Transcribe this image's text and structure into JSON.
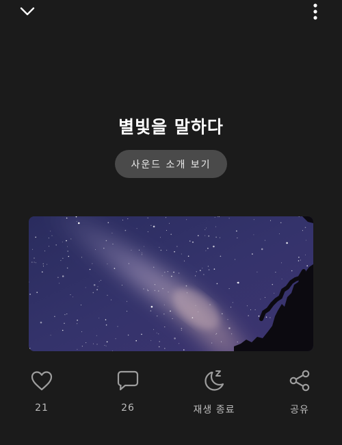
{
  "player": {
    "title": "별빛을 말하다",
    "intro_button_label": "사운드 소개 보기"
  },
  "top_bar": {
    "collapse_icon": "chevron-down-icon",
    "more_icon": "more-vertical-icon"
  },
  "cover": {
    "description_icon": "milky-way-night-sky-image"
  },
  "actions": {
    "like": {
      "icon": "heart-icon",
      "count": "21"
    },
    "comment": {
      "icon": "comment-icon",
      "count": "26"
    },
    "sleep_timer": {
      "icon": "moon-zzz-icon",
      "label": "재생 종료"
    },
    "share": {
      "icon": "share-icon",
      "label": "공유"
    }
  },
  "colors": {
    "background": "#1b1b1b",
    "button_bg": "#4a4a4a",
    "icon": "#9e9e9e",
    "label": "#bdbdbd"
  }
}
